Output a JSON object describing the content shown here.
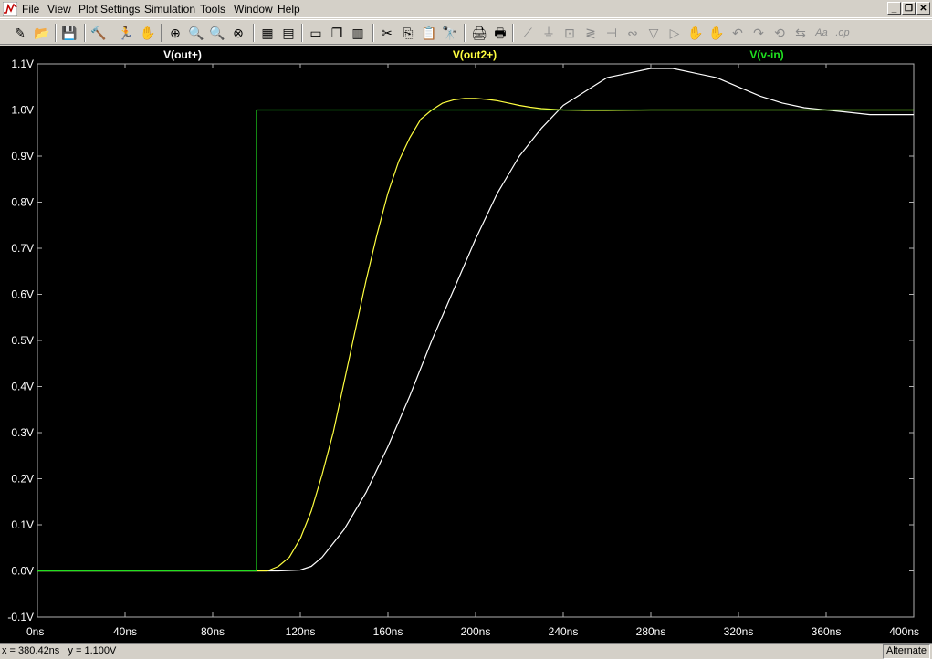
{
  "menu": {
    "items": [
      {
        "label": "File"
      },
      {
        "label": "View"
      },
      {
        "label": "Plot Settings"
      },
      {
        "label": "Simulation"
      },
      {
        "label": "Tools"
      },
      {
        "label": "Window"
      },
      {
        "label": "Help"
      }
    ]
  },
  "window_controls": {
    "minimize": "_",
    "restore": "❐",
    "close": "✕"
  },
  "toolbar": {
    "buttons": [
      {
        "name": "edit-schematic-icon",
        "glyph": "✎"
      },
      {
        "name": "open-icon",
        "glyph": "📂"
      },
      {
        "name": "save-icon",
        "glyph": "💾"
      },
      {
        "name": "control-panel-icon",
        "glyph": "🔨"
      },
      {
        "name": "run-icon",
        "glyph": "🏃"
      },
      {
        "name": "halt-icon",
        "glyph": "✋"
      },
      {
        "name": "zoom-area-icon",
        "glyph": "⊕"
      },
      {
        "name": "zoom-in-icon",
        "glyph": "🔍"
      },
      {
        "name": "zoom-out-icon",
        "glyph": "🔍"
      },
      {
        "name": "zoom-cancel-icon",
        "glyph": "⊗"
      },
      {
        "name": "autorange-icon",
        "glyph": "▦"
      },
      {
        "name": "autorange-y-icon",
        "glyph": "▤"
      },
      {
        "name": "tile-horizontal-icon",
        "glyph": "▭"
      },
      {
        "name": "cascade-icon",
        "glyph": "❐"
      },
      {
        "name": "tile-vertical-icon",
        "glyph": "▥"
      },
      {
        "name": "cut-icon",
        "glyph": "✂"
      },
      {
        "name": "copy-icon",
        "glyph": "⎘"
      },
      {
        "name": "paste-icon",
        "glyph": "📋"
      },
      {
        "name": "find-icon",
        "glyph": "🔭"
      },
      {
        "name": "page-setup-icon",
        "glyph": "🖨"
      },
      {
        "name": "print-icon",
        "glyph": "🖶"
      },
      {
        "name": "wire-icon",
        "glyph": "⟋"
      },
      {
        "name": "ground-icon",
        "glyph": "⏚"
      },
      {
        "name": "label-net-icon",
        "glyph": "⊡"
      },
      {
        "name": "resistor-icon",
        "glyph": "≷"
      },
      {
        "name": "capacitor-icon",
        "glyph": "⊣"
      },
      {
        "name": "inductor-icon",
        "glyph": "∾"
      },
      {
        "name": "diode-icon",
        "glyph": "▽"
      },
      {
        "name": "component-icon",
        "glyph": "▷"
      },
      {
        "name": "move-icon",
        "glyph": "✋"
      },
      {
        "name": "drag-icon",
        "glyph": "✋"
      },
      {
        "name": "undo-icon",
        "glyph": "↶"
      },
      {
        "name": "redo-icon",
        "glyph": "↷"
      },
      {
        "name": "rotate-icon",
        "glyph": "⟲"
      },
      {
        "name": "mirror-icon",
        "glyph": "⇆"
      },
      {
        "name": "text-icon",
        "glyph": "Aa"
      },
      {
        "name": "spice-directive-icon",
        "glyph": ".op"
      }
    ]
  },
  "traces": [
    {
      "label": "V(out+)",
      "color": "#ffffff"
    },
    {
      "label": "V(out2+)",
      "color": "#ffff40"
    },
    {
      "label": "V(v-in)",
      "color": "#20e020"
    }
  ],
  "chart_data": {
    "type": "line",
    "xlabel": "",
    "ylabel": "",
    "x_unit": "ns",
    "y_unit": "V",
    "xlim": [
      0,
      400
    ],
    "ylim": [
      -0.1,
      1.1
    ],
    "x_ticks": [
      "0ns",
      "40ns",
      "80ns",
      "120ns",
      "160ns",
      "200ns",
      "240ns",
      "280ns",
      "320ns",
      "360ns",
      "400ns"
    ],
    "y_ticks": [
      "1.1V",
      "1.0V",
      "0.9V",
      "0.8V",
      "0.7V",
      "0.6V",
      "0.5V",
      "0.4V",
      "0.3V",
      "0.2V",
      "0.1V",
      "0.0V",
      "-0.1V"
    ],
    "grid": false,
    "series": [
      {
        "name": "V(out+)",
        "color": "#ffffff",
        "x": [
          0,
          100,
          110,
          120,
          125,
          130,
          140,
          150,
          160,
          170,
          180,
          190,
          200,
          210,
          220,
          230,
          240,
          250,
          260,
          270,
          280,
          290,
          300,
          310,
          320,
          330,
          340,
          350,
          360,
          370,
          380,
          390,
          400
        ],
        "y": [
          0,
          0,
          0,
          0.002,
          0.01,
          0.03,
          0.09,
          0.17,
          0.27,
          0.38,
          0.5,
          0.61,
          0.72,
          0.82,
          0.9,
          0.96,
          1.01,
          1.04,
          1.07,
          1.08,
          1.09,
          1.09,
          1.08,
          1.07,
          1.05,
          1.03,
          1.015,
          1.005,
          1.0,
          0.995,
          0.99,
          0.99,
          0.99
        ]
      },
      {
        "name": "V(out2+)",
        "color": "#ffff40",
        "x": [
          0,
          100,
          105,
          110,
          115,
          120,
          125,
          130,
          135,
          140,
          145,
          150,
          155,
          160,
          165,
          170,
          175,
          180,
          185,
          190,
          195,
          200,
          205,
          210,
          215,
          220,
          225,
          230,
          240,
          250,
          260,
          280,
          300,
          320,
          340,
          360,
          380,
          400
        ],
        "y": [
          0,
          0,
          0,
          0.01,
          0.03,
          0.07,
          0.13,
          0.21,
          0.3,
          0.41,
          0.52,
          0.63,
          0.73,
          0.82,
          0.89,
          0.94,
          0.98,
          1.0,
          1.015,
          1.022,
          1.025,
          1.025,
          1.023,
          1.02,
          1.015,
          1.01,
          1.006,
          1.003,
          1.0,
          0.999,
          0.999,
          1.0,
          1.0,
          1.0,
          1.0,
          1.0,
          1.0,
          1.0
        ]
      },
      {
        "name": "V(v-in)",
        "color": "#20e020",
        "x": [
          0,
          100,
          100,
          400
        ],
        "y": [
          0,
          0,
          1,
          1
        ]
      }
    ]
  },
  "status": {
    "coords": "x = 380.42ns   y = 1.100V",
    "mode": "Alternate"
  }
}
